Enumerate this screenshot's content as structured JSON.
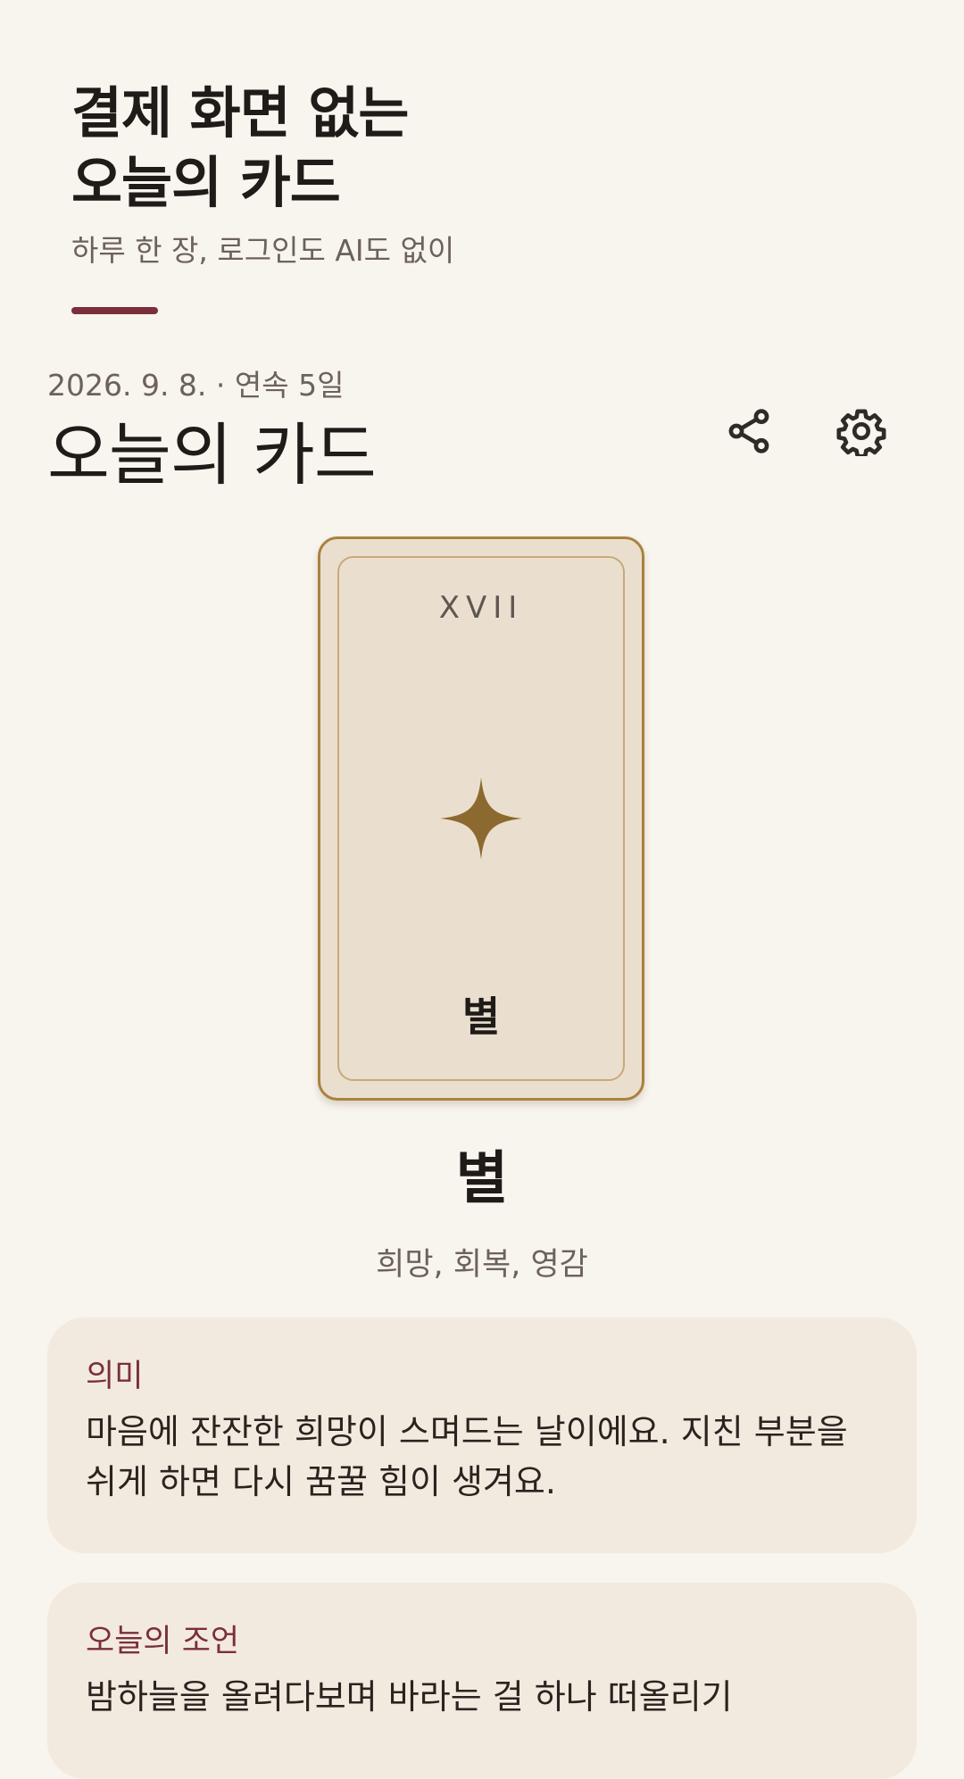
{
  "hero": {
    "title": "결제 화면 없는\n오늘의 카드",
    "subtitle": "하루 한 장, 로그인도 AI도 없이"
  },
  "header": {
    "date_line": "2026. 9. 8. · 연속 5일",
    "title": "오늘의 카드"
  },
  "icons": {
    "share": "share-icon",
    "settings": "gear-icon",
    "card_symbol": "four-point-star-icon"
  },
  "card": {
    "numeral": "XVII",
    "name": "별"
  },
  "result": {
    "title": "별",
    "keywords": "희망, 회복, 영감"
  },
  "sections": {
    "meaning": {
      "label": "의미",
      "text": "마음에 잔잔한 희망이 스며드는 날이에요. 지친 부분을 쉬게 하면 다시 꿈꿀 힘이 생겨요."
    },
    "advice": {
      "label": "오늘의 조언",
      "text": "밤하늘을 올려다보며 바라는 걸 하나 떠올리기"
    }
  },
  "colors": {
    "background": "#f8f4ee",
    "accent": "#7a2f3b",
    "card_gold": "#8c6a2f",
    "card_face": "#eadfcf",
    "panel": "#f3eadf"
  }
}
